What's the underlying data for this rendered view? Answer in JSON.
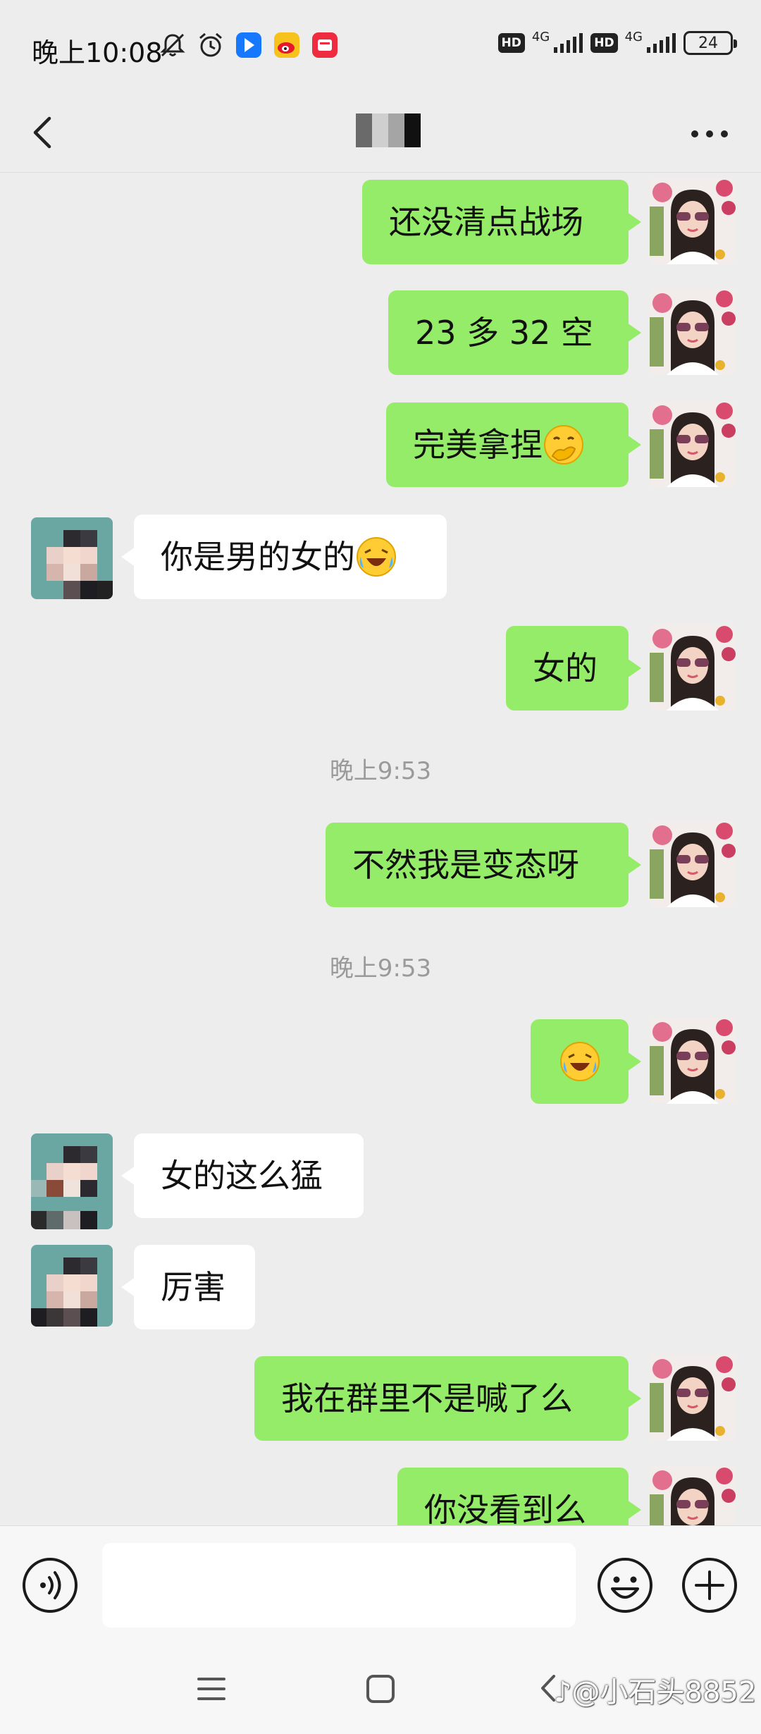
{
  "status_bar": {
    "time": "晚上10:08",
    "icons": [
      "mute-icon",
      "alarm-icon",
      "app-blue-icon",
      "weibo-icon",
      "app-red-icon"
    ],
    "sim1": {
      "hd": "HD",
      "network": "4G"
    },
    "sim2": {
      "hd": "HD",
      "network": "4G"
    },
    "battery": "24"
  },
  "header": {
    "title": "",
    "more_icon": "more-dots-icon",
    "back_icon": "chevron-left-icon"
  },
  "messages": [
    {
      "side": "me",
      "text": "还没清点战场"
    },
    {
      "side": "me",
      "text": "23 多 32 空"
    },
    {
      "side": "me",
      "text": "完美拿捏",
      "emoji": "hand-over-mouth-emoji"
    },
    {
      "side": "other",
      "text": "你是男的女的",
      "emoji": "crying-laughing-emoji"
    },
    {
      "side": "me",
      "text": "女的"
    },
    {
      "type": "time",
      "text": "晚上9:53"
    },
    {
      "side": "me",
      "text": "不然我是变态呀"
    },
    {
      "type": "time",
      "text": "晚上9:53"
    },
    {
      "side": "me",
      "text": "",
      "emoji": "crying-laughing-emoji"
    },
    {
      "side": "other",
      "text": "女的这么猛"
    },
    {
      "side": "other",
      "text": "厉害"
    },
    {
      "side": "me",
      "text": "我在群里不是喊了么"
    },
    {
      "side": "me",
      "text": "你没看到么"
    }
  ],
  "input_bar": {
    "voice_icon": "voice-icon",
    "input_value": "",
    "emoji_icon": "smiley-icon",
    "plus_icon": "plus-icon"
  },
  "nav_bar": {
    "watermark": "小石头8852"
  },
  "colors": {
    "bubble_me": "#95ec69",
    "bubble_other": "#ffffff",
    "background": "#ededed"
  }
}
